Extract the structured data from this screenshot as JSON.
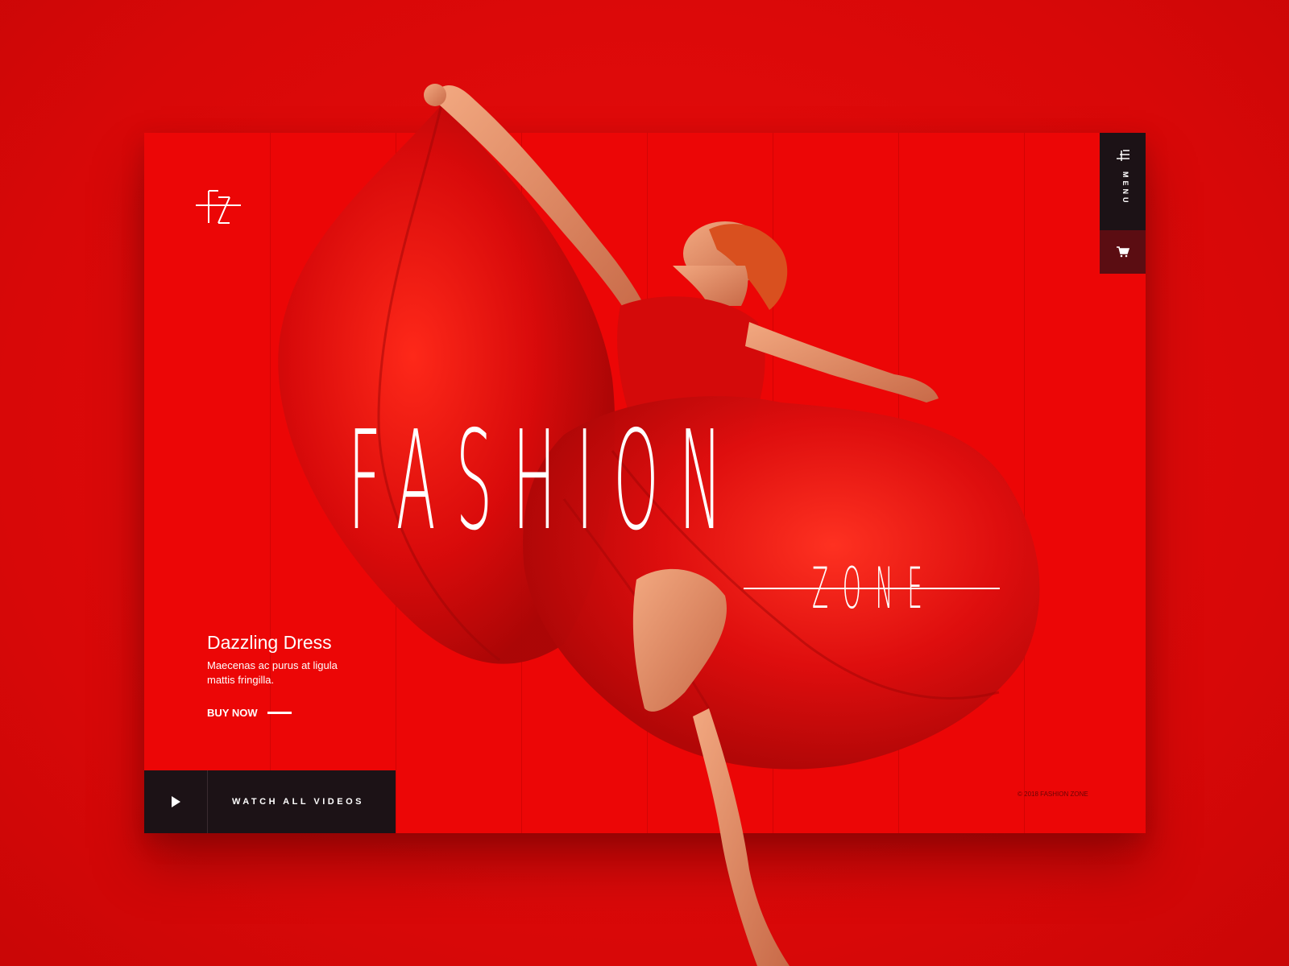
{
  "brand": {
    "logo_text": "FZ",
    "title": "FASHION",
    "subtitle": "ZONE"
  },
  "promo": {
    "title": "Dazzling Dress",
    "description": "Maecenas ac purus at ligula mattis fringilla.",
    "cta_label": "BUY NOW"
  },
  "videos": {
    "label": "WATCH ALL VIDEOS",
    "icon": "play-icon"
  },
  "nav": {
    "menu_label": "MENU",
    "menu_icon": "hamburger-icon",
    "cart_icon": "cart-icon"
  },
  "footer": {
    "copyright": "© 2018 FASHION ZONE"
  },
  "colors": {
    "background": "#e20a0a",
    "panel_dark": "#1c1216",
    "cart_bg": "#5b0d12",
    "text": "#ffffff"
  }
}
